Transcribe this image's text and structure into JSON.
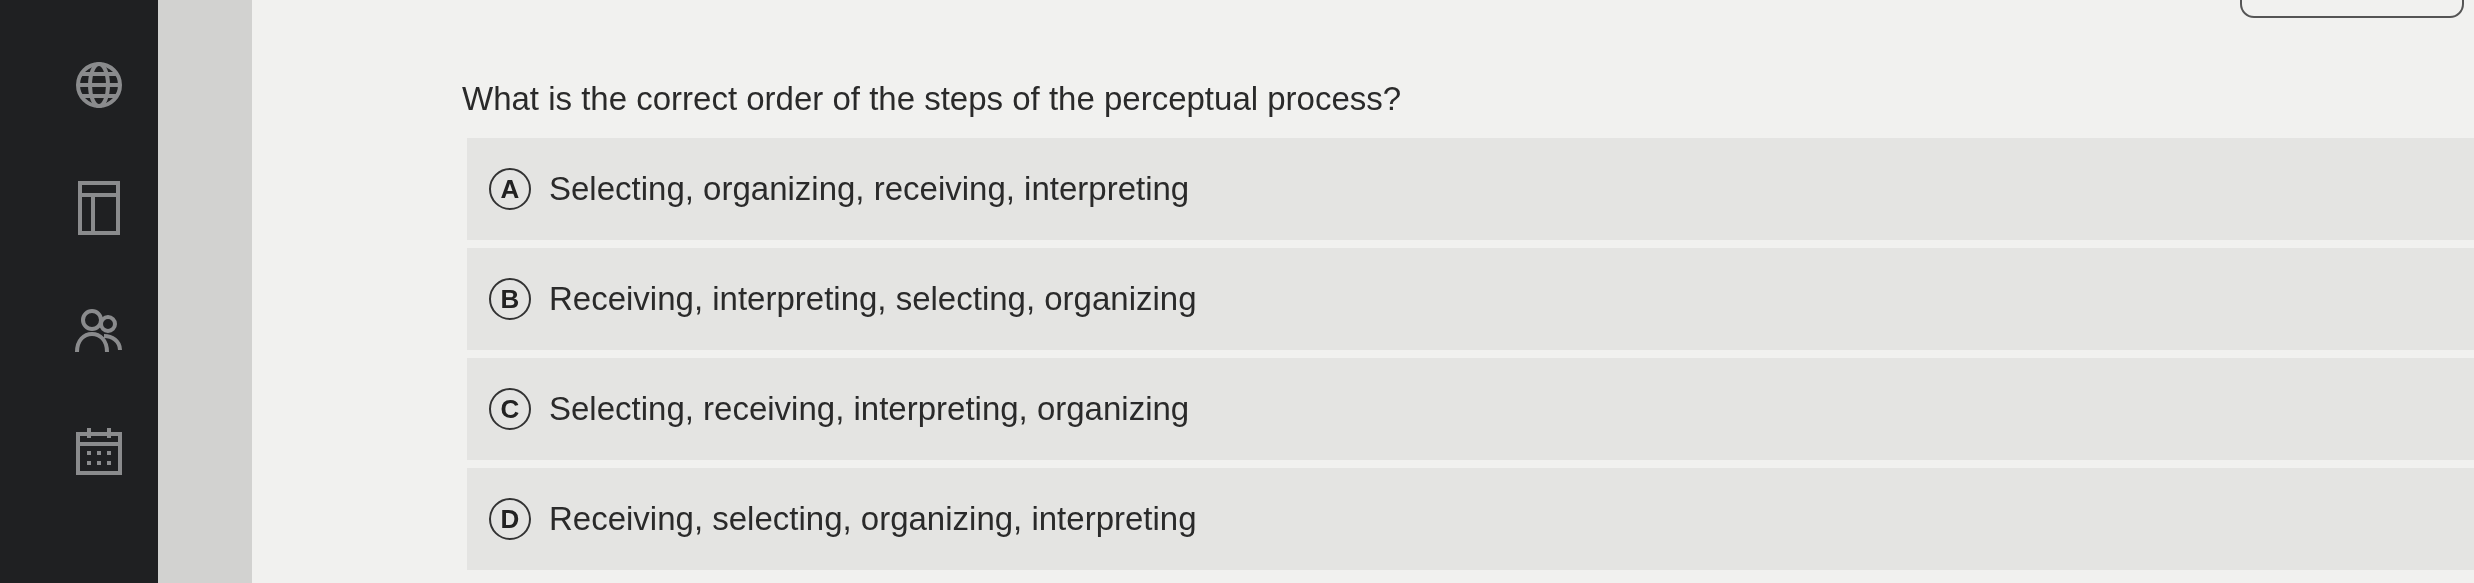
{
  "question": "What is the correct order of the steps of the perceptual process?",
  "options": [
    {
      "letter": "A",
      "text": "Selecting, organizing, receiving, interpreting"
    },
    {
      "letter": "B",
      "text": "Receiving, interpreting, selecting, organizing"
    },
    {
      "letter": "C",
      "text": "Selecting, receiving, interpreting, organizing"
    },
    {
      "letter": "D",
      "text": "Receiving, selecting, organizing, interpreting"
    }
  ]
}
